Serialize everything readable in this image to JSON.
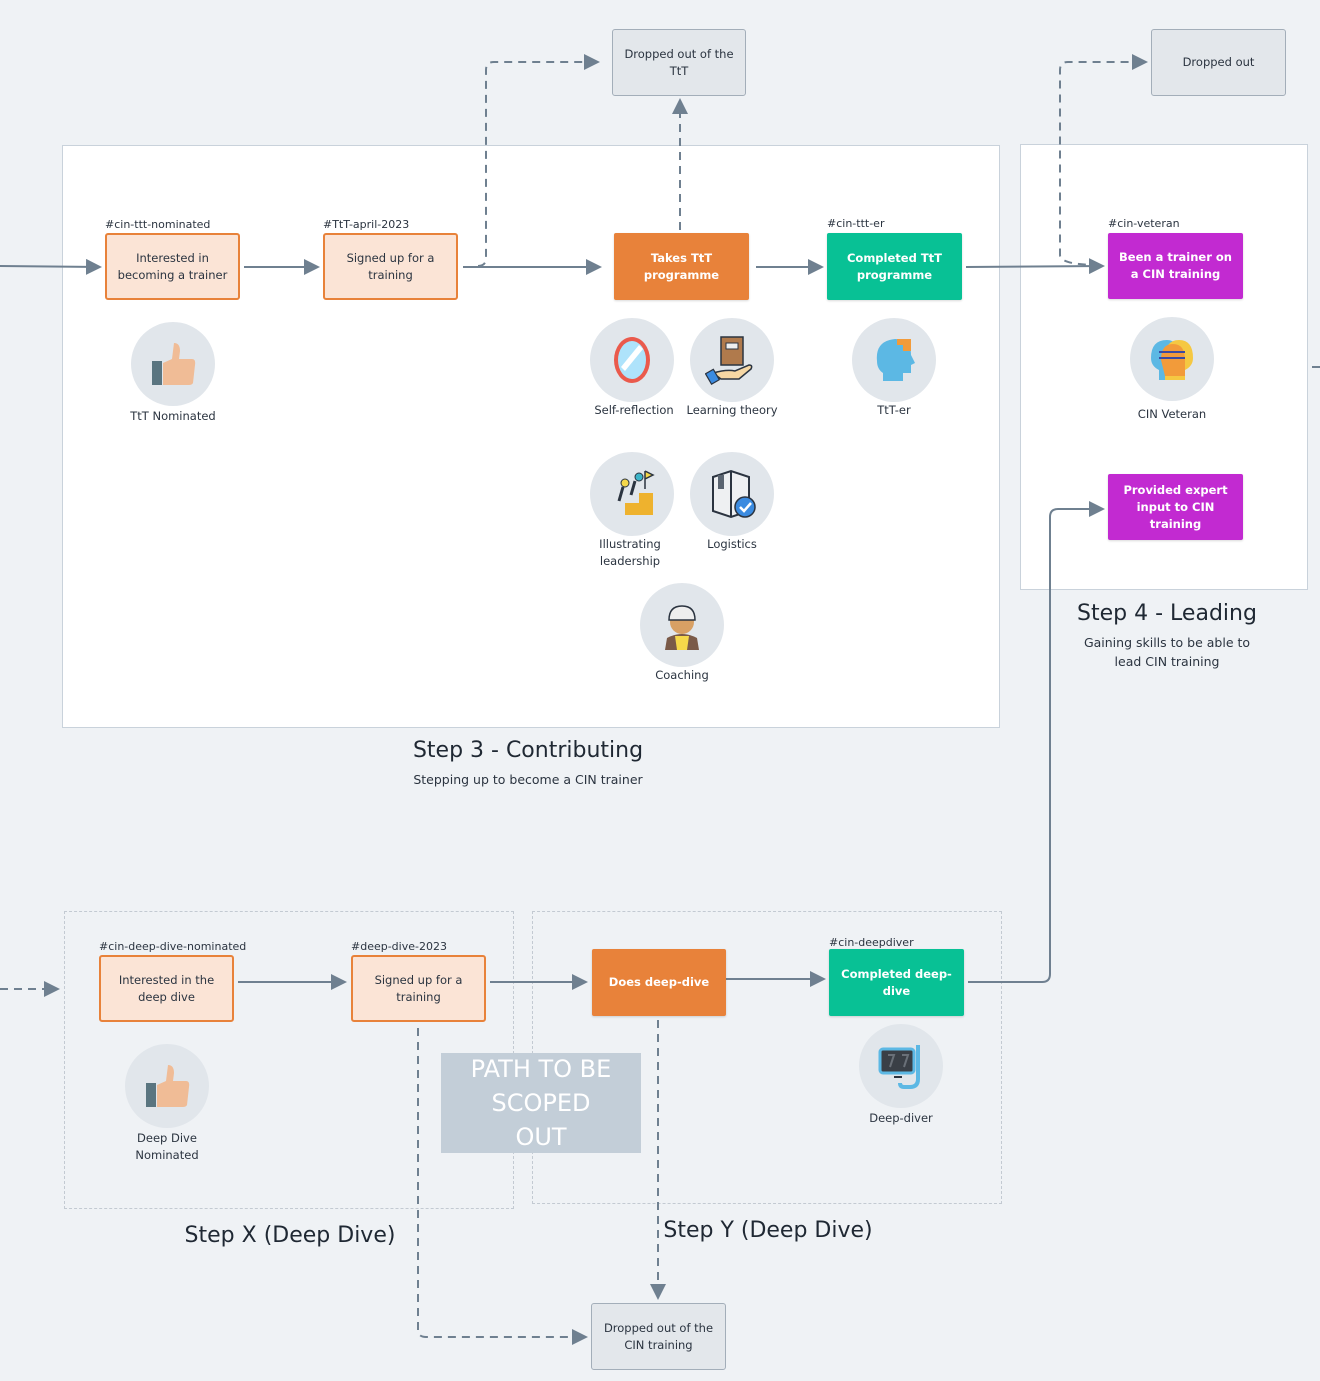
{
  "steps": {
    "step3": {
      "title": "Step 3 - Contributing",
      "subtitle": "Stepping up to become a CIN trainer"
    },
    "step4": {
      "title": "Step 4 - Leading",
      "subtitle": "Gaining skills to be able to lead CIN training"
    },
    "stepX": {
      "title": "Step X (Deep Dive)"
    },
    "stepY": {
      "title": "Step Y (Deep Dive)"
    }
  },
  "nodes": {
    "ttt_interested": {
      "tag": "#cin-ttt-nominated",
      "label": "Interested in becoming a trainer"
    },
    "ttt_signed_up": {
      "tag": "#TtT-april-2023",
      "label": "Signed up for a training"
    },
    "ttt_takes": {
      "label": "Takes TtT programme"
    },
    "ttt_completed": {
      "tag": "#cin-ttt-er",
      "label": "Completed TtT programme"
    },
    "veteran_trainer": {
      "tag": "#cin-veteran",
      "label": "Been a trainer on a CIN training"
    },
    "expert_input": {
      "label": "Provided expert input to CIN training"
    },
    "dropped_ttt": {
      "label": "Dropped out of the TtT"
    },
    "dropped_out": {
      "label": "Dropped out"
    },
    "dd_interested": {
      "tag": "#cin-deep-dive-nominated",
      "label": "Interested in the deep dive"
    },
    "dd_signed_up": {
      "tag": "#deep-dive-2023",
      "label": "Signed up for a training"
    },
    "dd_does": {
      "label": "Does deep-dive"
    },
    "dd_completed": {
      "tag": "#cin-deepdiver",
      "label": "Completed deep-dive"
    },
    "dropped_cin": {
      "label": "Dropped out of the CIN training"
    }
  },
  "badges": {
    "ttt_nominated": {
      "icon": "thumbs-up-icon",
      "label": "TtT Nominated"
    },
    "self_reflection": {
      "icon": "mirror-icon",
      "label": "Self-reflection"
    },
    "learning_theory": {
      "icon": "book-in-hand-icon",
      "label": "Learning theory"
    },
    "ttt_er": {
      "icon": "head-profile-icon",
      "label": "TtT-er"
    },
    "illustrating_leadership": {
      "icon": "climbing-leader-icon",
      "label": "Illustrating leadership"
    },
    "logistics": {
      "icon": "box-check-icon",
      "label": "Logistics"
    },
    "coaching": {
      "icon": "coach-icon",
      "label": "Coaching"
    },
    "cin_veteran": {
      "icon": "heads-exchange-icon",
      "label": "CIN Veteran"
    },
    "deep_dive_nominated": {
      "icon": "thumbs-up-icon",
      "label": "Deep Dive Nominated"
    },
    "deep_diver": {
      "icon": "snorkel-mask-icon",
      "label": "Deep-diver"
    }
  },
  "scope_note": {
    "label": "PATH TO BE SCOPED OUT"
  },
  "colors": {
    "lead_fill": "#fbe4d6",
    "lead_border": "#e8823a",
    "action": "#e8823a",
    "done": "#08c195",
    "veteran": "#c22ad1",
    "drop": "#e3e7eb",
    "connector": "#6f8090"
  }
}
